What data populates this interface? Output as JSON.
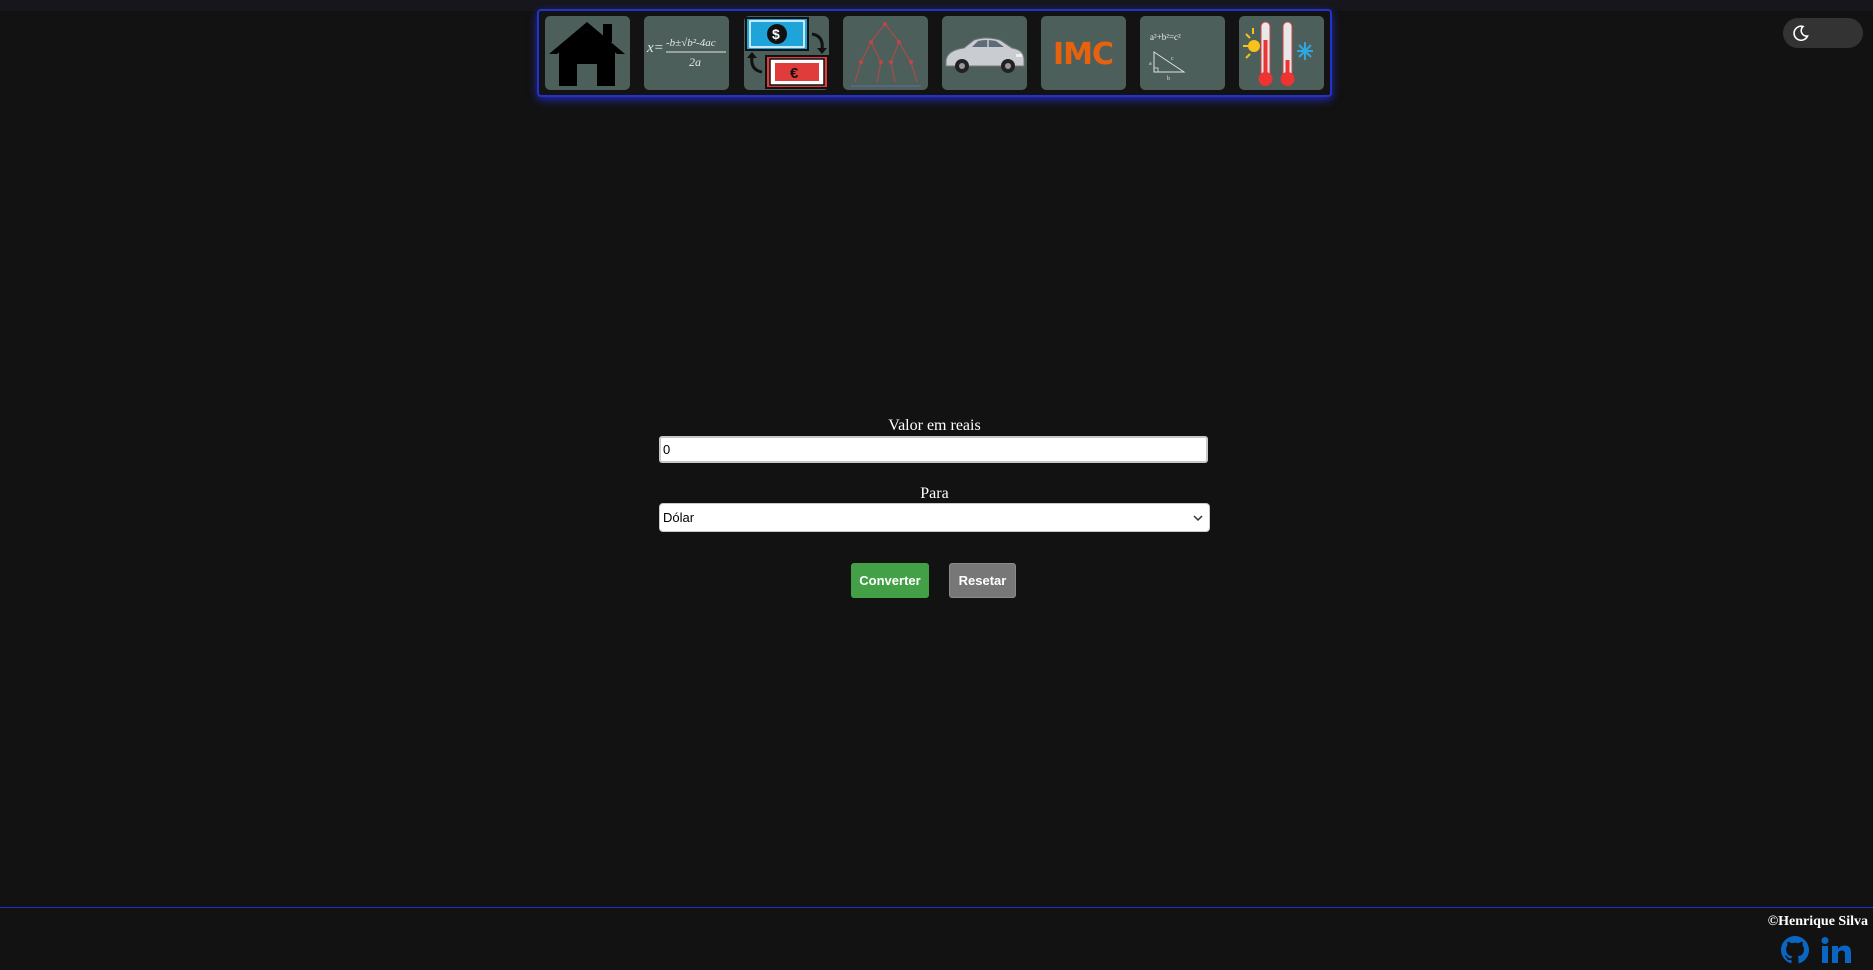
{
  "nav": {
    "items": [
      {
        "name": "home",
        "icon": "house-icon"
      },
      {
        "name": "bhaskara",
        "icon": "quadratic-formula-icon",
        "text": "x= -b±√b²-4ac",
        "subtext": "2a"
      },
      {
        "name": "currency-converter",
        "icon": "currency-exchange-icon",
        "dollar": "$",
        "euro": "€"
      },
      {
        "name": "tree",
        "icon": "tree-diagram-icon"
      },
      {
        "name": "car",
        "icon": "car-icon"
      },
      {
        "name": "imc",
        "icon": "imc-icon",
        "text": "IMC"
      },
      {
        "name": "pythagoras",
        "icon": "pythagoras-icon",
        "text": "a²+b²=c²"
      },
      {
        "name": "temperature",
        "icon": "thermometer-icon"
      }
    ],
    "border_color": "#2233cc"
  },
  "theme_toggle": {
    "icon": "moon-icon"
  },
  "form": {
    "amount_label": "Valor em reais",
    "amount_value": "0",
    "target_label": "Para",
    "target_selected": "Dólar",
    "convert_label": "Converter",
    "reset_label": "Resetar"
  },
  "footer": {
    "copyright": "©Henrique Silva",
    "github_icon": "github-icon",
    "linkedin_icon": "linkedin-icon",
    "accent_color": "#0a66c2"
  },
  "colors": {
    "background": "#121212",
    "tile": "#4d5f5b",
    "convert": "#43a047",
    "reset": "#777777"
  }
}
